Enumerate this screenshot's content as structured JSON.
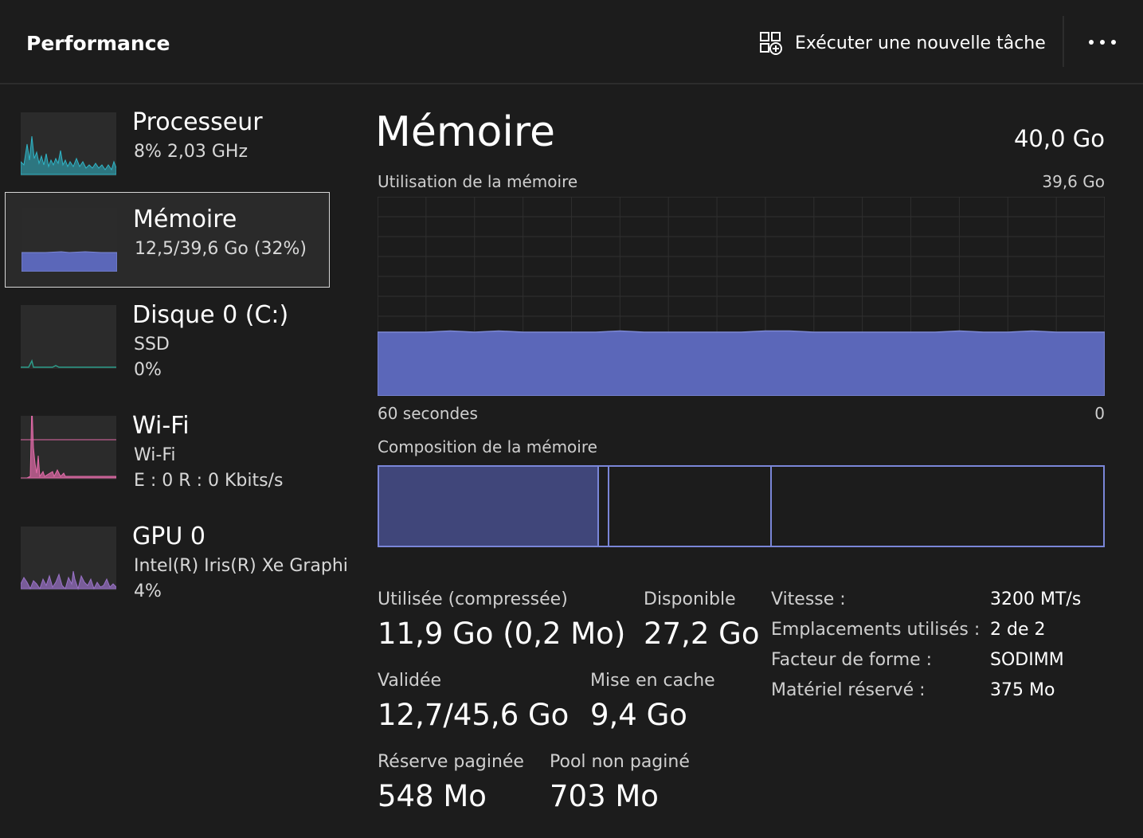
{
  "header": {
    "title": "Performance",
    "run_task_label": "Exécuter une nouvelle tâche"
  },
  "sidebar": {
    "items": [
      {
        "title": "Processeur",
        "lines": [
          "8%  2,03 GHz"
        ],
        "color": "#2fb5c7"
      },
      {
        "title": "Mémoire",
        "lines": [
          "12,5/39,6 Go (32%)"
        ],
        "color": "#5b67b9",
        "selected": true
      },
      {
        "title": "Disque 0 (C:)",
        "lines": [
          "SSD",
          "0%"
        ],
        "color": "#2d9c8a"
      },
      {
        "title": "Wi-Fi",
        "lines": [
          "Wi-Fi",
          "E : 0  R : 0 Kbits/s"
        ],
        "color": "#e36ba9"
      },
      {
        "title": "GPU 0",
        "lines": [
          "Intel(R) Iris(R) Xe Graphi",
          "4%"
        ],
        "color": "#9a72c8"
      }
    ]
  },
  "main": {
    "title": "Mémoire",
    "total": "40,0 Go",
    "usage_label": "Utilisation de la mémoire",
    "usage_max": "39,6 Go",
    "time_left": "60 secondes",
    "time_right": "0",
    "composition_label": "Composition de la mémoire",
    "usage_fraction": 0.32,
    "accent_color": "#5b67b9"
  },
  "stats": {
    "used_label": "Utilisée (compressée)",
    "used_value": "11,9 Go (0,2 Mo)",
    "available_label": "Disponible",
    "available_value": "27,2 Go",
    "committed_label": "Validée",
    "committed_value": "12,7/45,6 Go",
    "cached_label": "Mise en cache",
    "cached_value": "9,4 Go",
    "paged_label": "Réserve paginée",
    "paged_value": "548 Mo",
    "nonpaged_label": "Pool non paginé",
    "nonpaged_value": "703 Mo"
  },
  "info": {
    "speed_label": "Vitesse :",
    "speed_value": "3200 MT/s",
    "slots_label": "Emplacements utilisés :",
    "slots_value": "2 de 2",
    "form_label": "Facteur de forme :",
    "form_value": "SODIMM",
    "reserved_label": "Matériel réservé :",
    "reserved_value": "375 Mo"
  }
}
